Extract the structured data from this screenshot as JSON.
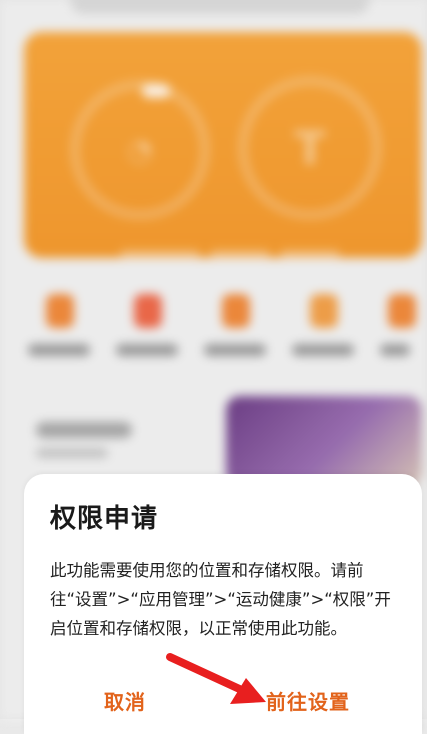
{
  "dialog": {
    "title": "权限申请",
    "message": "此功能需要使用您的位置和存储权限。请前往“设置”>“应用管理”>“运动健康”>“权限”开启位置和存储权限，以正常使用此功能。",
    "cancel_label": "取消",
    "settings_label": "前往设置"
  },
  "colors": {
    "accent": "#e2631b",
    "hero_orange": "#f39a2e",
    "annotation_red": "#e81f1f"
  },
  "icons": [
    "red-arrow-pointer-icon"
  ]
}
